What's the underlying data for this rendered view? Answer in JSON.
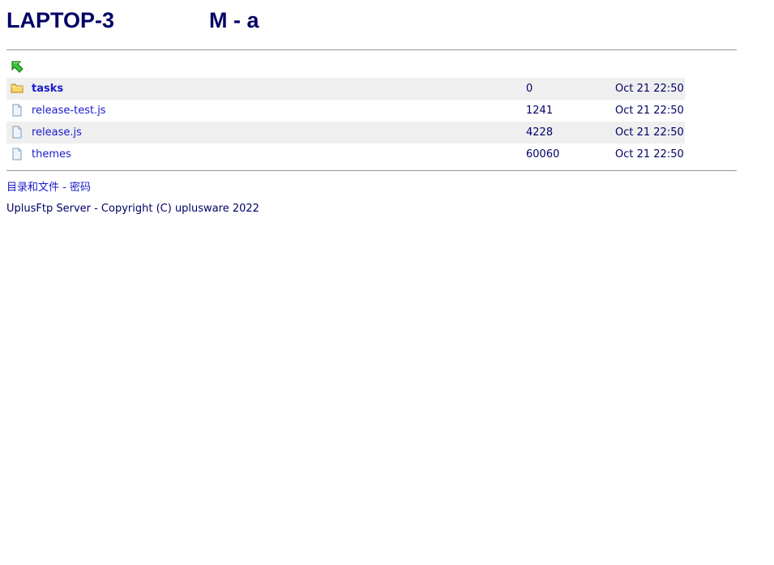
{
  "header": {
    "host": "LAPTOP-3",
    "path": "M - a"
  },
  "navigation": {
    "up_icon": "green-up-arrow-icon"
  },
  "listing": {
    "rows": [
      {
        "name": "tasks",
        "type": "folder",
        "icon": "folder-icon",
        "size": "0",
        "modified": "Oct 21 22:50"
      },
      {
        "name": "release-test.js",
        "type": "file",
        "icon": "file-icon",
        "size": "1241",
        "modified": "Oct 21 22:50"
      },
      {
        "name": "release.js",
        "type": "file",
        "icon": "file-icon",
        "size": "4228",
        "modified": "Oct 21 22:50"
      },
      {
        "name": "themes",
        "type": "file",
        "icon": "file-icon",
        "size": "60060",
        "modified": "Oct 21 22:50"
      }
    ]
  },
  "footer": {
    "link_files": "目录和文件",
    "separator": " - ",
    "link_password": "密码",
    "copyright": "UplusFtp Server - Copyright (C) uplusware 2022"
  },
  "colors": {
    "text": "#000066",
    "link": "#1a1acc",
    "alt_row": "#efefef",
    "rule": "#999999"
  }
}
